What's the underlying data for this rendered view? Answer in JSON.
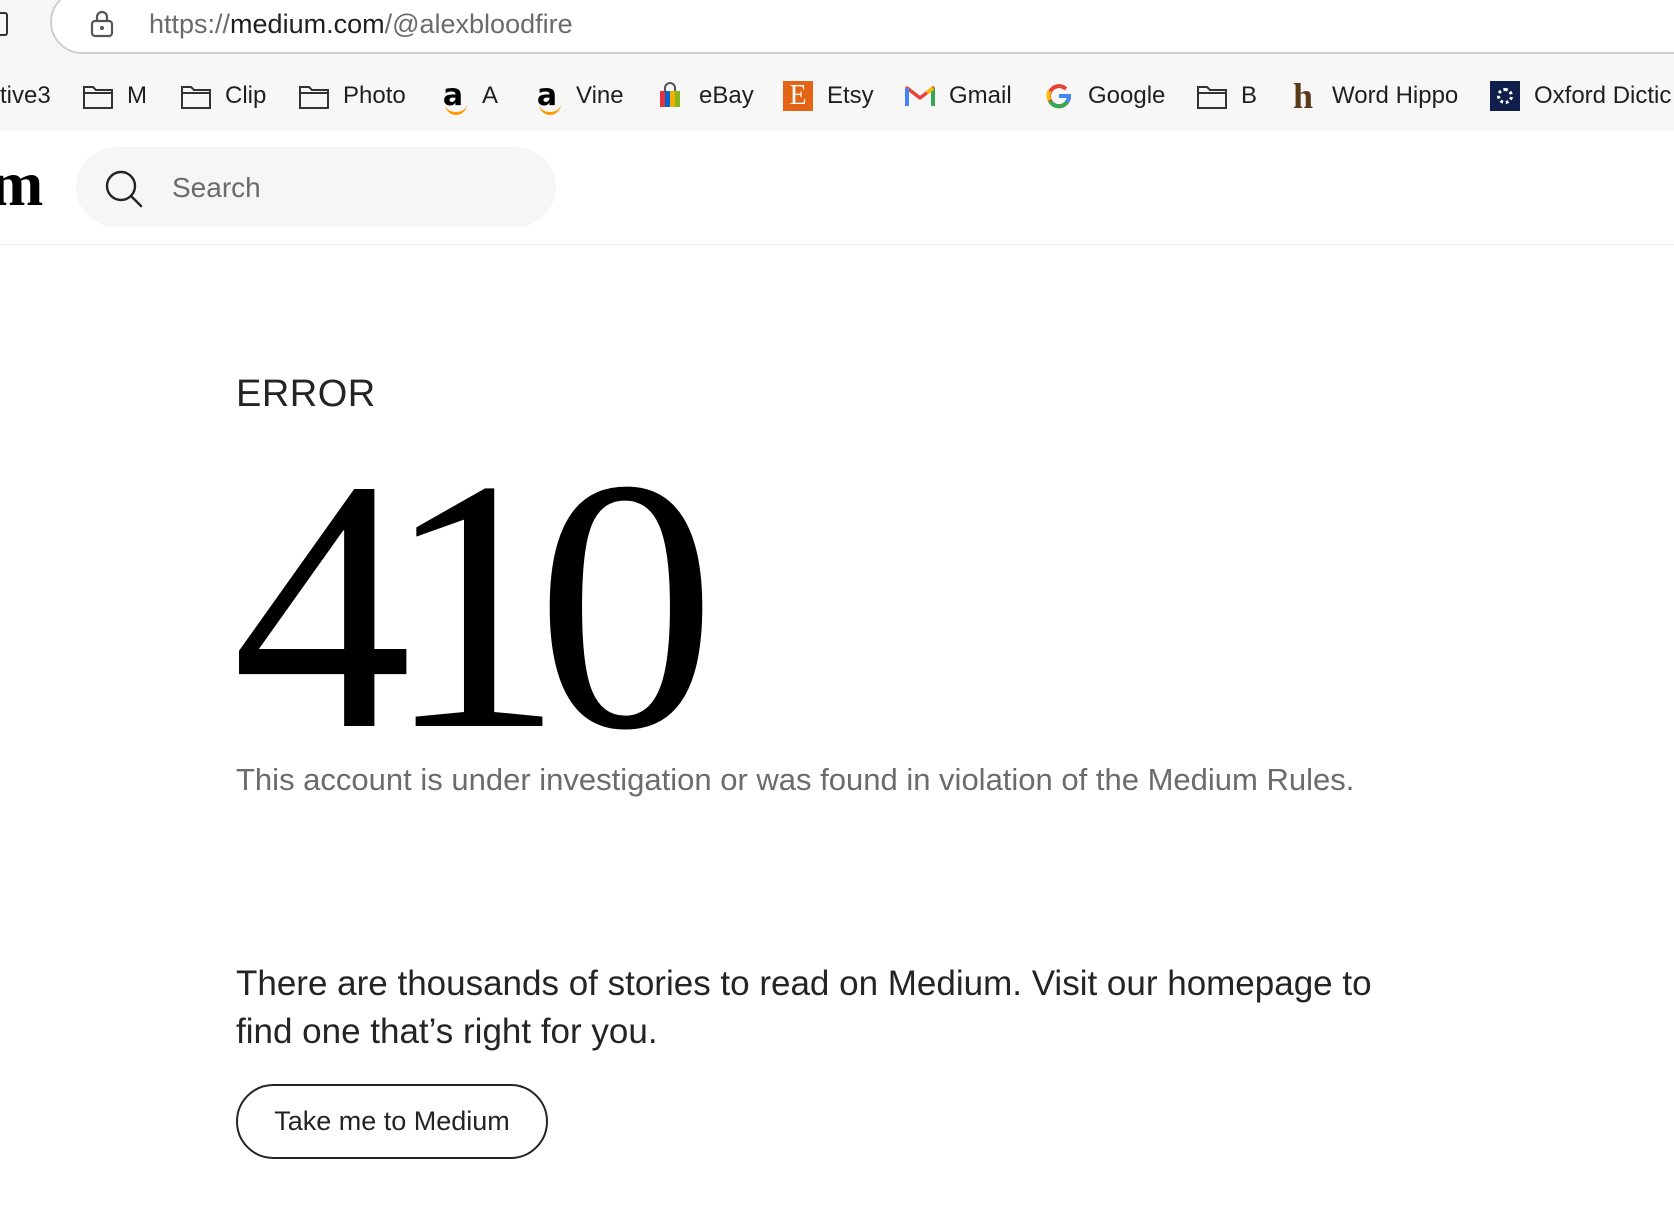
{
  "browser": {
    "url_prefix": "https://",
    "url_host": "medium.com",
    "url_path": "/@alexbloodfire",
    "bookmarks": [
      {
        "label": "tive3",
        "icon": "none"
      },
      {
        "label": "M",
        "icon": "folder-icon"
      },
      {
        "label": "Clip",
        "icon": "folder-icon"
      },
      {
        "label": "Photo",
        "icon": "folder-icon"
      },
      {
        "label": "A",
        "icon": "amazon-icon"
      },
      {
        "label": "Vine",
        "icon": "amazon-icon"
      },
      {
        "label": "eBay",
        "icon": "shopping-bag-icon"
      },
      {
        "label": "Etsy",
        "icon": "etsy-icon",
        "glyph": "E"
      },
      {
        "label": "Gmail",
        "icon": "gmail-icon"
      },
      {
        "label": "Google",
        "icon": "google-icon"
      },
      {
        "label": "B",
        "icon": "folder-icon"
      },
      {
        "label": "Word Hippo",
        "icon": "wordhippo-icon",
        "glyph": "h"
      },
      {
        "label": "Oxford Dictic",
        "icon": "oxford-icon"
      }
    ]
  },
  "header": {
    "logo_text": "m",
    "search_placeholder": "Search"
  },
  "error": {
    "label": "ERROR",
    "code": "410",
    "message": "This account is under investigation or was found in violation of the Medium Rules.",
    "suggestion": "There are thousands of stories to read on Medium. Visit our homepage to find one that’s right for you.",
    "button_label": "Take me to Medium"
  },
  "colors": {
    "text_primary": "#242424",
    "text_secondary": "#6b6b6b",
    "search_bg": "#f6f6f6",
    "etsy_orange": "#e36414",
    "oxford_navy": "#0f1e4a"
  }
}
